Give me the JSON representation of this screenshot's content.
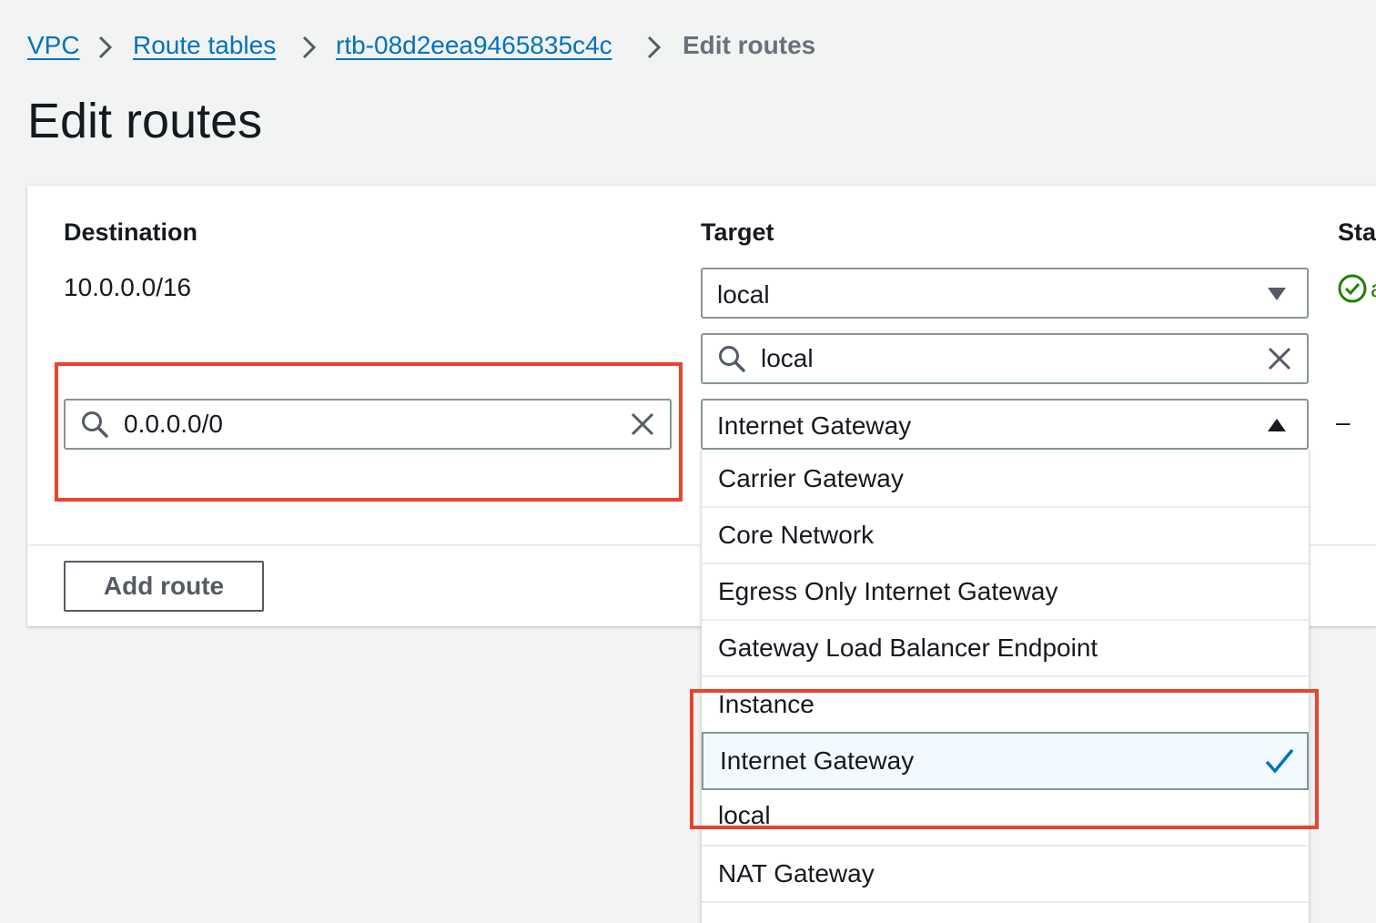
{
  "breadcrumb": {
    "items": [
      "VPC",
      "Route tables",
      "rtb-08d2eea9465835c4c"
    ],
    "current": "Edit routes"
  },
  "page_title": "Edit routes",
  "columns": {
    "destination": "Destination",
    "target": "Target",
    "status": "Sta"
  },
  "routes": [
    {
      "destination": "10.0.0.0/16",
      "target_type": "local",
      "target_search": "local",
      "status": "active"
    },
    {
      "destination": "0.0.0.0/0",
      "target_type": "Internet Gateway",
      "status": "–"
    }
  ],
  "add_route_label": "Add route",
  "target_options": [
    "Carrier Gateway",
    "Core Network",
    "Egress Only Internet Gateway",
    "Gateway Load Balancer Endpoint",
    "Instance",
    "Internet Gateway",
    "local",
    "NAT Gateway"
  ],
  "selected_option": "Internet Gateway",
  "colors": {
    "link": "#0073bb",
    "success": "#1d8102",
    "highlight": "#e8442e",
    "selected_bg": "#f1faff",
    "check": "#0073bb"
  },
  "icons": {
    "separator": "chevron-right-icon",
    "search": "search-icon",
    "clear": "close-icon",
    "dropdown_closed": "caret-down-icon",
    "dropdown_open": "caret-up-icon",
    "status": "check-circle-icon",
    "selected": "checkmark-icon"
  }
}
